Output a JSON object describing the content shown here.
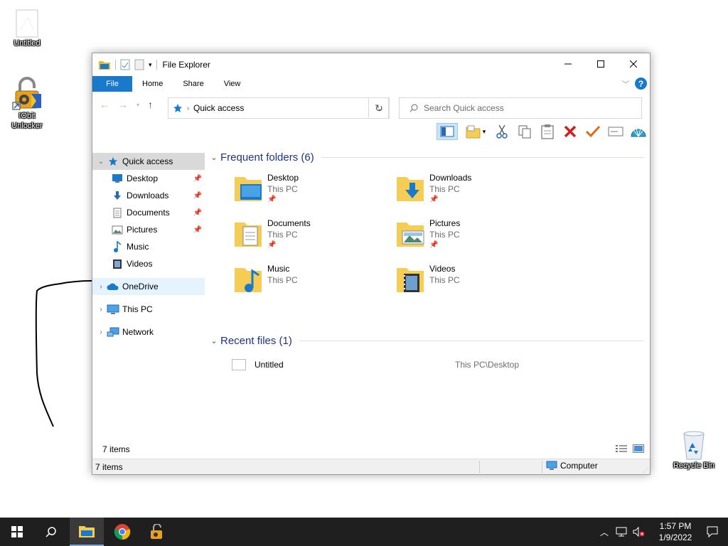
{
  "desktop": {
    "icons": [
      {
        "label": "Untitled"
      },
      {
        "label": "IObit\nUnlocker"
      },
      {
        "label": "Recycle Bin"
      }
    ]
  },
  "window": {
    "title": "File Explorer",
    "tabs": {
      "file": "File",
      "home": "Home",
      "share": "Share",
      "view": "View"
    },
    "address": "Quick access",
    "search_placeholder": "Search Quick access",
    "help": "?"
  },
  "sidebar": {
    "quick_access": "Quick access",
    "items": [
      {
        "label": "Desktop",
        "pinned": true
      },
      {
        "label": "Downloads",
        "pinned": true
      },
      {
        "label": "Documents",
        "pinned": true
      },
      {
        "label": "Pictures",
        "pinned": true
      },
      {
        "label": "Music",
        "pinned": false
      },
      {
        "label": "Videos",
        "pinned": false
      }
    ],
    "onedrive": "OneDrive",
    "thispc": "This PC",
    "network": "Network"
  },
  "content": {
    "frequent_header": "Frequent folders (6)",
    "folders": [
      {
        "name": "Desktop",
        "location": "This PC"
      },
      {
        "name": "Downloads",
        "location": "This PC"
      },
      {
        "name": "Documents",
        "location": "This PC"
      },
      {
        "name": "Pictures",
        "location": "This PC"
      },
      {
        "name": "Music",
        "location": "This PC"
      },
      {
        "name": "Videos",
        "location": "This PC"
      }
    ],
    "recent_header": "Recent files (1)",
    "recent": [
      {
        "name": "Untitled",
        "path": "This PC\\Desktop"
      }
    ]
  },
  "status": {
    "items_inner": "7 items",
    "items_bar": "7 items",
    "computer": "Computer"
  },
  "taskbar": {
    "time": "1:57 PM",
    "date": "1/9/2022"
  },
  "colors": {
    "accent": "#1979ca",
    "section_header": "#1e3287",
    "taskbar": "#1f1f1f"
  }
}
